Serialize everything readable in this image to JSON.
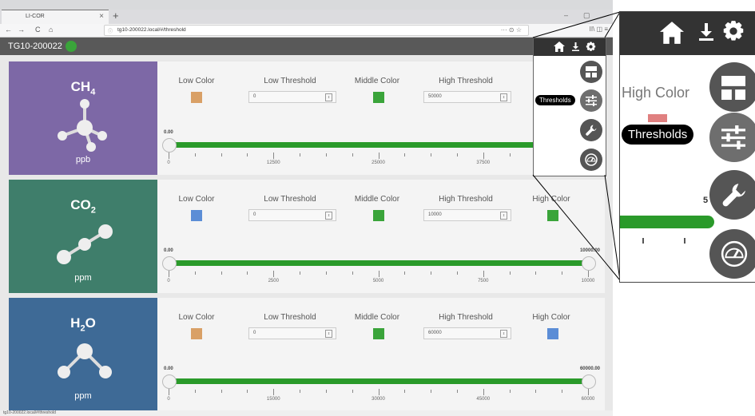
{
  "browser": {
    "tab_title": "LI-COR",
    "tab_close": "×",
    "new_tab": "+",
    "url": "tg10-200022.local/#/threshold",
    "status_url": "tg10-200022.local/#/threshold",
    "url_actions": "··· ⊙ ☆",
    "toolbar_icons": "II\\  ◫  ≡",
    "nav_back": "←",
    "nav_forward": "→",
    "nav_reload": "C",
    "nav_home": "⌂",
    "win_min": "–",
    "win_max": "▢"
  },
  "app": {
    "device": "TG10-200022",
    "device_status_color": "#3aa43a"
  },
  "headers": {
    "low_color": "Low Color",
    "low_threshold": "Low Threshold",
    "middle_color": "Middle Color",
    "high_threshold": "High Threshold",
    "high_color": "High Color"
  },
  "gases": [
    {
      "name": "CH",
      "subscript": "4",
      "unit": "ppb",
      "bg": "#7d68a6",
      "low_color": "#d9a066",
      "middle_color": "#3aa43a",
      "high_color": "#e08080",
      "low_threshold": "0",
      "high_threshold": "50000",
      "min_label": "0.00",
      "max_label": "5",
      "range_max": 50000,
      "tick_labels": [
        "0",
        "12500",
        "25000",
        "37500"
      ],
      "high_fraction": 1.0
    },
    {
      "name": "CO",
      "subscript": "2",
      "unit": "ppm",
      "bg": "#3f7e6b",
      "low_color": "#5b8dd6",
      "middle_color": "#3aa43a",
      "high_color": "#3aa43a",
      "low_threshold": "0",
      "high_threshold": "10000",
      "min_label": "0.00",
      "max_label": "10000.00",
      "range_max": 10000,
      "tick_labels": [
        "0",
        "2500",
        "5000",
        "7500",
        "10000"
      ],
      "high_fraction": 1.0
    },
    {
      "name": "H",
      "subscript": "2",
      "name_suffix": "O",
      "unit": "ppm",
      "bg": "#3e6a96",
      "low_color": "#d9a066",
      "middle_color": "#3aa43a",
      "high_color": "#5b8dd6",
      "low_threshold": "0",
      "high_threshold": "60000",
      "min_label": "0.00",
      "max_label": "60000.00",
      "range_max": 60000,
      "tick_labels": [
        "0",
        "15000",
        "30000",
        "45000",
        "60000"
      ],
      "high_fraction": 1.0
    }
  ],
  "menu": {
    "tooltip": "Thresholds",
    "zoom_high_color": "High Color",
    "zoom_max_label": "5",
    "icons": [
      "home-icon",
      "download-icon",
      "gear-icon",
      "layout-icon",
      "sliders-icon",
      "wrench-icon",
      "gauge-icon"
    ]
  }
}
